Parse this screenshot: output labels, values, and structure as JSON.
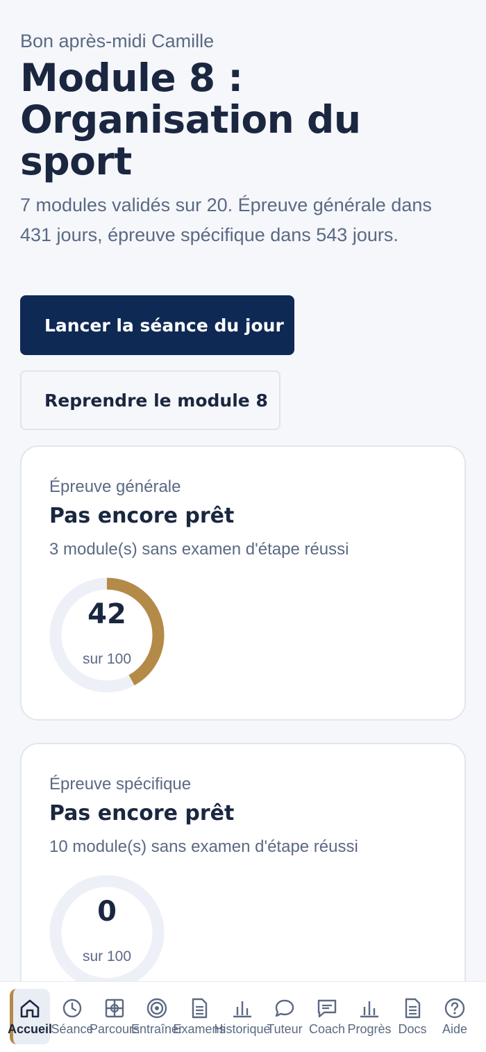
{
  "header": {
    "greeting": "Bon après-midi Camille",
    "title": "Module 8 : Organisation du sport",
    "subtitle": "7 modules validés sur 20. Épreuve générale dans 431 jours, épreuve spécifique dans 543 jours."
  },
  "actions": {
    "primary_label": "Lancer la séance du jour",
    "secondary_label": "Reprendre le module 8"
  },
  "cards": [
    {
      "label": "Épreuve générale",
      "status": "Pas encore prêt",
      "note": "3 module(s) sans examen d'étape réussi",
      "score": "42",
      "score_value": 42,
      "score_unit": "sur 100"
    },
    {
      "label": "Épreuve spécifique",
      "status": "Pas encore prêt",
      "note": "10 module(s) sans examen d'étape réussi",
      "score": "0",
      "score_value": 0,
      "score_unit": "sur 100"
    }
  ],
  "colors": {
    "accent_gold": "#b48a48",
    "primary_navy": "#0f2955",
    "track": "#edf0f6"
  },
  "nav": {
    "items": [
      {
        "label": "Accueil",
        "icon": "home-icon",
        "active": true
      },
      {
        "label": "Séance",
        "icon": "clock-icon"
      },
      {
        "label": "Parcours",
        "icon": "map-grid-icon"
      },
      {
        "label": "Entraîner",
        "icon": "target-icon"
      },
      {
        "label": "Examens",
        "icon": "document-icon"
      },
      {
        "label": "Historique",
        "icon": "bar-chart-icon"
      },
      {
        "label": "Tuteur",
        "icon": "chat-bubble-icon"
      },
      {
        "label": "Coach",
        "icon": "message-square-icon"
      },
      {
        "label": "Progrès",
        "icon": "bar-chart-icon"
      },
      {
        "label": "Docs",
        "icon": "document-icon"
      },
      {
        "label": "Aide",
        "icon": "help-icon"
      }
    ]
  }
}
